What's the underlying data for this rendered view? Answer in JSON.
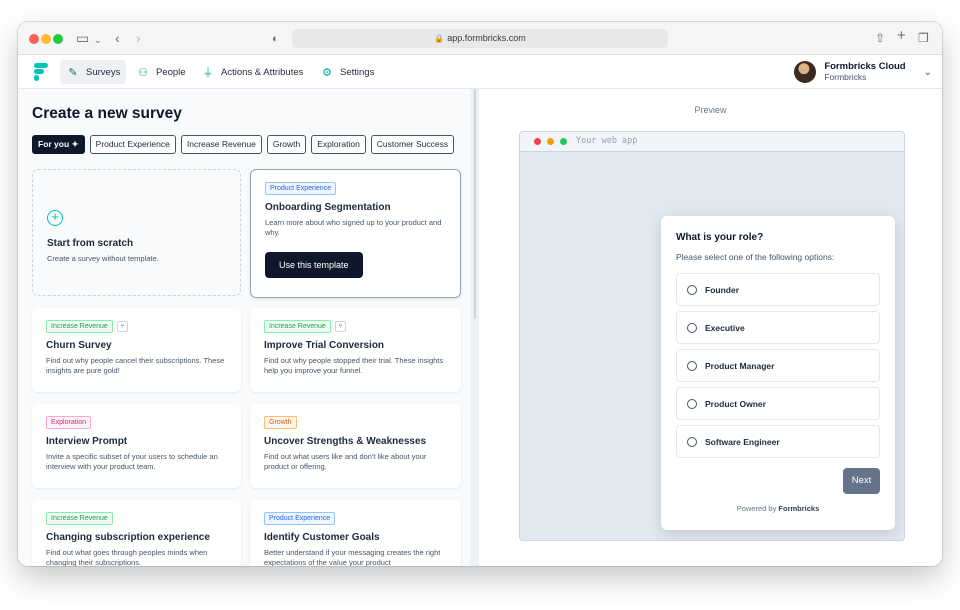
{
  "browser": {
    "url": "app.formbricks.com"
  },
  "nav": {
    "items": [
      {
        "label": "Surveys",
        "icon": "surveys-icon"
      },
      {
        "label": "People",
        "icon": "people-icon"
      },
      {
        "label": "Actions & Attributes",
        "icon": "actions-icon"
      },
      {
        "label": "Settings",
        "icon": "settings-icon"
      }
    ],
    "active": "Surveys",
    "account_name": "Formbricks Cloud",
    "account_org": "Formbricks"
  },
  "page": {
    "title": "Create a new survey"
  },
  "filters": [
    "For you",
    "Product Experience",
    "Increase Revenue",
    "Growth",
    "Exploration",
    "Customer Success"
  ],
  "scratch": {
    "title": "Start from scratch",
    "desc": "Create a survey without template."
  },
  "templates": [
    {
      "tag": "Product Experience",
      "title": "Onboarding Segmentation",
      "desc": "Learn more about who signed up to your product and why.",
      "button": "Use this template"
    },
    {
      "tag": "Increase Revenue",
      "title": "Churn Survey",
      "desc": "Find out why people cancel their subscriptions. These insights are pure gold!"
    },
    {
      "tag": "Increase Revenue",
      "title": "Improve Trial Conversion",
      "desc": "Find out why people stopped their trial. These insights help you improve your funnel."
    },
    {
      "tag": "Exploration",
      "title": "Interview Prompt",
      "desc": "Invite a specific subset of your users to schedule an interview with your product team."
    },
    {
      "tag": "Growth",
      "title": "Uncover Strengths & Weaknesses",
      "desc": "Find out what users like and don't like about your product or offering."
    },
    {
      "tag": "Increase Revenue",
      "title": "Changing subscription experience",
      "desc": "Find out what goes through peoples minds when changing their subscriptions."
    },
    {
      "tag": "Product Experience",
      "title": "Identify Customer Goals",
      "desc": "Better understand if your messaging creates the right expectations of the value your product"
    }
  ],
  "preview": {
    "label": "Preview",
    "mock_title": "Your web app",
    "question": "What is your role?",
    "subheader": "Please select one of the following options:",
    "options": [
      "Founder",
      "Executive",
      "Product Manager",
      "Product Owner",
      "Software Engineer"
    ],
    "next": "Next",
    "powered_prefix": "Powered by",
    "powered_brand": "Formbricks"
  },
  "colors": {
    "brand": "#00c4b8",
    "primary": "#0f172a",
    "next_button": "#64748b"
  }
}
